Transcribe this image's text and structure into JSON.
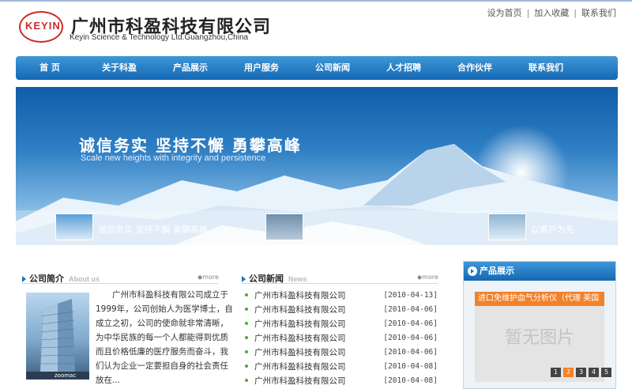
{
  "header": {
    "logo_text": "KEYIN",
    "company_cn": "广州市科盈科技有限公司",
    "company_en": "Keyin Science  & Technology Ltd.Guangzhou,China",
    "top_links": [
      "设为首页",
      "加入收藏",
      "联系我们"
    ]
  },
  "nav": {
    "items": [
      "首 页",
      "关于科盈",
      "产品展示",
      "用户服务",
      "公司新闻",
      "人才招聘",
      "合作伙伴",
      "联系我们"
    ]
  },
  "banner": {
    "slogan": "诚信务实  坚持不懈  勇攀高峰",
    "subtitle": "Scale new heights with integrity and persistence",
    "thumbs": [
      {
        "label": "诚信务实 坚持不懈 勇攀高峰"
      },
      {
        "label": "科盈产品云集"
      },
      {
        "label": "以客户为先"
      }
    ]
  },
  "intro": {
    "title": "公司简介",
    "title_en": "About us",
    "more": "more",
    "image_caption": "zoomac",
    "text": "广州市科盈科技有限公司成立于1999年，公司创始人为医学博士，自成立之初，公司的使命就非常清晰，为中华民族的每一个人都能得到优质而且价格低廉的医疗服务而奋斗，我们认为企业一定要担自身的社会责任放在..."
  },
  "news": {
    "title": "公司新闻",
    "title_en": "News",
    "more": "more",
    "items": [
      {
        "title": "广州市科盈科技有限公司",
        "date": "[2010-04-13]"
      },
      {
        "title": "广州市科盈科技有限公司",
        "date": "[2010-04-06]"
      },
      {
        "title": "广州市科盈科技有限公司",
        "date": "[2010-04-06]"
      },
      {
        "title": "广州市科盈科技有限公司",
        "date": "[2010-04-06]"
      },
      {
        "title": "广州市科盈科技有限公司",
        "date": "[2010-04-06]"
      },
      {
        "title": "广州市科盈科技有限公司",
        "date": "[2010-04-08]"
      },
      {
        "title": "广州市科盈科技有限公司",
        "date": "[2010-04-08]"
      }
    ]
  },
  "products": {
    "title": "产品展示",
    "product_name": "进口免维护血气分析仪（代理 美国",
    "no_image": "暂无图片",
    "pages": [
      "1",
      "2",
      "3",
      "4",
      "5"
    ],
    "active_page": "2"
  },
  "colors": {
    "nav_blue": "#1b73c0",
    "accent_orange": "#f2822a",
    "logo_red": "#cc2a2a",
    "news_dot_green": "#53a93f"
  }
}
